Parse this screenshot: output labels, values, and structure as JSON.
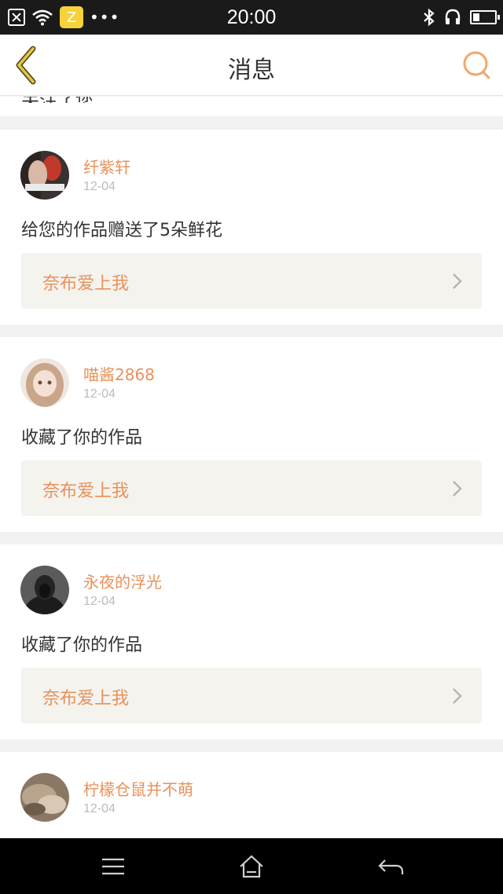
{
  "status_bar": {
    "time": "20:00",
    "app_badge": "Z",
    "more": "•••",
    "battery_level": 0.3
  },
  "header": {
    "title": "消息",
    "back_icon": "chevron-left-icon",
    "search_icon": "search-icon"
  },
  "partial_text": "关注了您",
  "notifications": [
    {
      "username": "纤紫轩",
      "date": "12-04",
      "message": "给您的作品赠送了5朵鲜花",
      "work_title": "奈布爱上我"
    },
    {
      "username": "喵酱2868",
      "date": "12-04",
      "message": "收藏了你的作品",
      "work_title": "奈布爱上我"
    },
    {
      "username": "永夜的浮光",
      "date": "12-04",
      "message": "收藏了你的作品",
      "work_title": "奈布爱上我"
    },
    {
      "username": "柠檬仓鼠并不萌",
      "date": "12-04"
    }
  ],
  "colors": {
    "accent": "#e8915a",
    "back_arrow": "#c9a227",
    "card_bg": "#ffffff",
    "page_bg": "#f2f2f2",
    "work_bg": "#f4f3ee"
  }
}
